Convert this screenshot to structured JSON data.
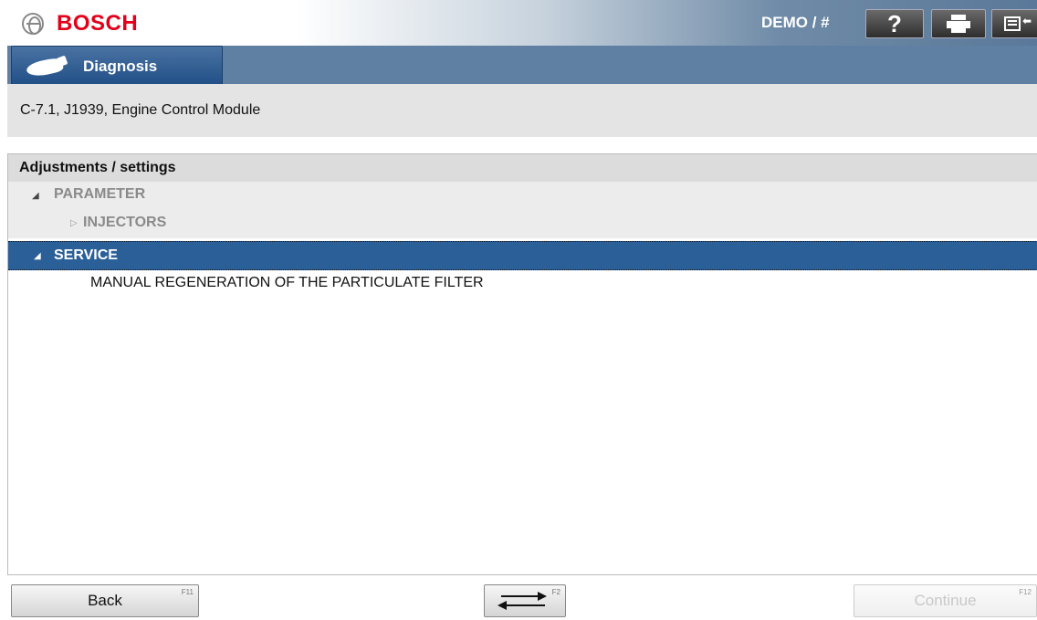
{
  "header": {
    "brand": "BOSCH",
    "user": "DEMO / #",
    "help_label": "?",
    "icons": [
      "bosch-logo-icon",
      "help-icon",
      "print-icon",
      "menu-exit-icon"
    ]
  },
  "nav": {
    "active_tab": "Diagnosis",
    "tab_icon": "car-icon"
  },
  "module": {
    "title": "C-7.1, J1939, Engine Control Module"
  },
  "content": {
    "section_title": "Adjustments / settings",
    "tree": [
      {
        "label": "PARAMETER",
        "state": "expanded",
        "selected": false
      },
      {
        "label": "INJECTORS",
        "state": "collapsed",
        "selected": false
      },
      {
        "label": "SERVICE",
        "state": "expanded",
        "selected": true
      },
      {
        "label": "MANUAL REGENERATION OF THE PARTICULATE FILTER",
        "state": "leaf",
        "selected": false
      }
    ]
  },
  "footer": {
    "back_label": "Back",
    "back_key": "F11",
    "switch_key": "F2",
    "continue_label": "Continue",
    "continue_key": "F12",
    "continue_enabled": false
  },
  "colors": {
    "brand_red": "#e2001a",
    "selected_row": "#2b5f97",
    "nav_band": "#5f80a3",
    "disabled_text": "#c8c8c8"
  }
}
